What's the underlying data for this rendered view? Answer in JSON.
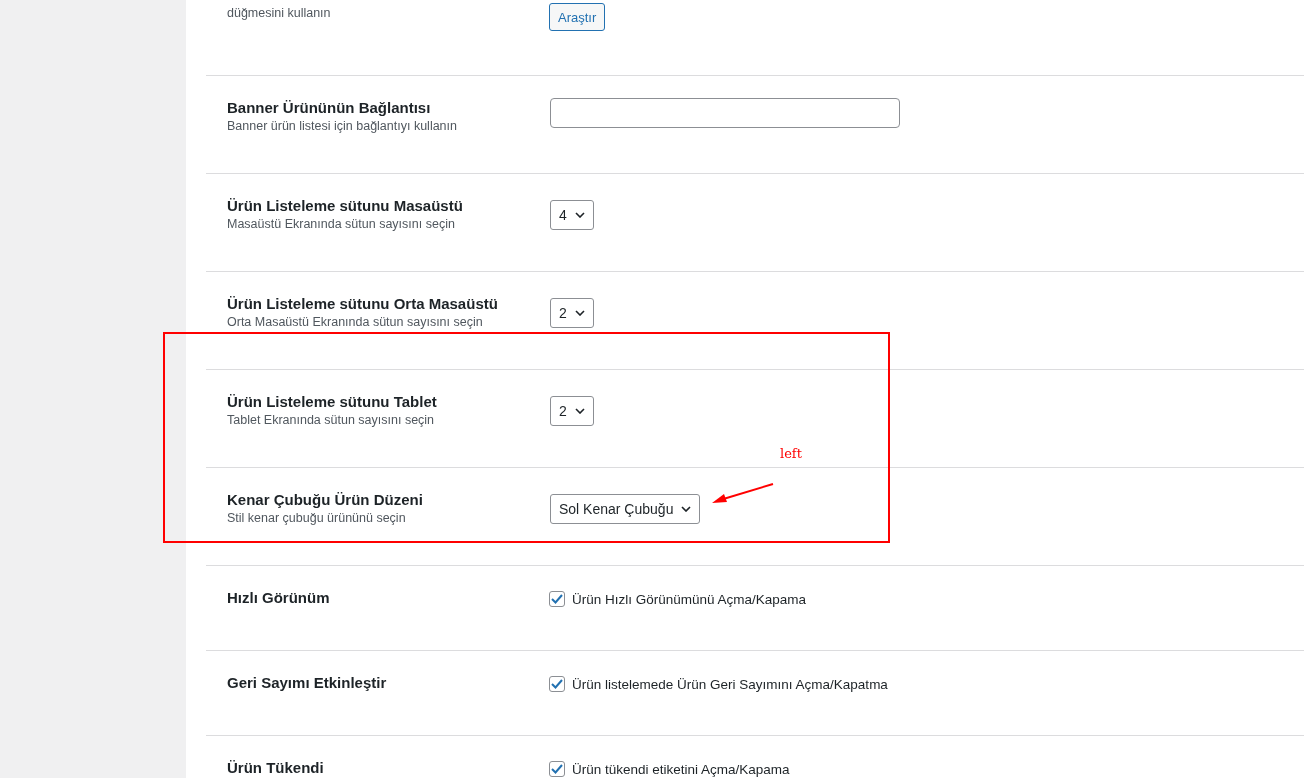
{
  "settings": [
    {
      "kind": "button",
      "description": "düğmesini kullanın",
      "button": "Araştır"
    },
    {
      "kind": "text",
      "title": "Banner Ürününün Bağlantısı",
      "description": "Banner ürün listesi için bağlantıyı kullanın"
    },
    {
      "kind": "select",
      "title": "Ürün Listeleme sütunu Masaüstü",
      "description": "Masaüstü Ekranında sütun sayısını seçin",
      "value": "4"
    },
    {
      "kind": "select",
      "title": "Ürün Listeleme sütunu Orta Masaüstü",
      "description": "Orta Masaüstü Ekranında sütun sayısını seçin",
      "value": "2"
    },
    {
      "kind": "select",
      "title": "Ürün Listeleme sütunu Tablet",
      "description": "Tablet Ekranında sütun sayısını seçin",
      "value": "2"
    },
    {
      "kind": "select",
      "title": "Kenar Çubuğu Ürün Düzeni",
      "description": "Stil kenar çubuğu ürününü seçin",
      "value": "Sol Kenar Çubuğu"
    },
    {
      "kind": "checkbox",
      "title": "Hızlı Görünüm",
      "label": "Ürün Hızlı Görünümünü Açma/Kapama",
      "checked": true
    },
    {
      "kind": "checkbox",
      "title": "Geri Sayımı Etkinleştir",
      "label": "Ürün listelemede Ürün Geri Sayımını Açma/Kapatma",
      "checked": true
    },
    {
      "kind": "checkbox",
      "title": "Ürün Tükendi",
      "label": "Ürün tükendi etiketini Açma/Kapama",
      "checked": true
    }
  ],
  "annotation": {
    "label": "left"
  }
}
